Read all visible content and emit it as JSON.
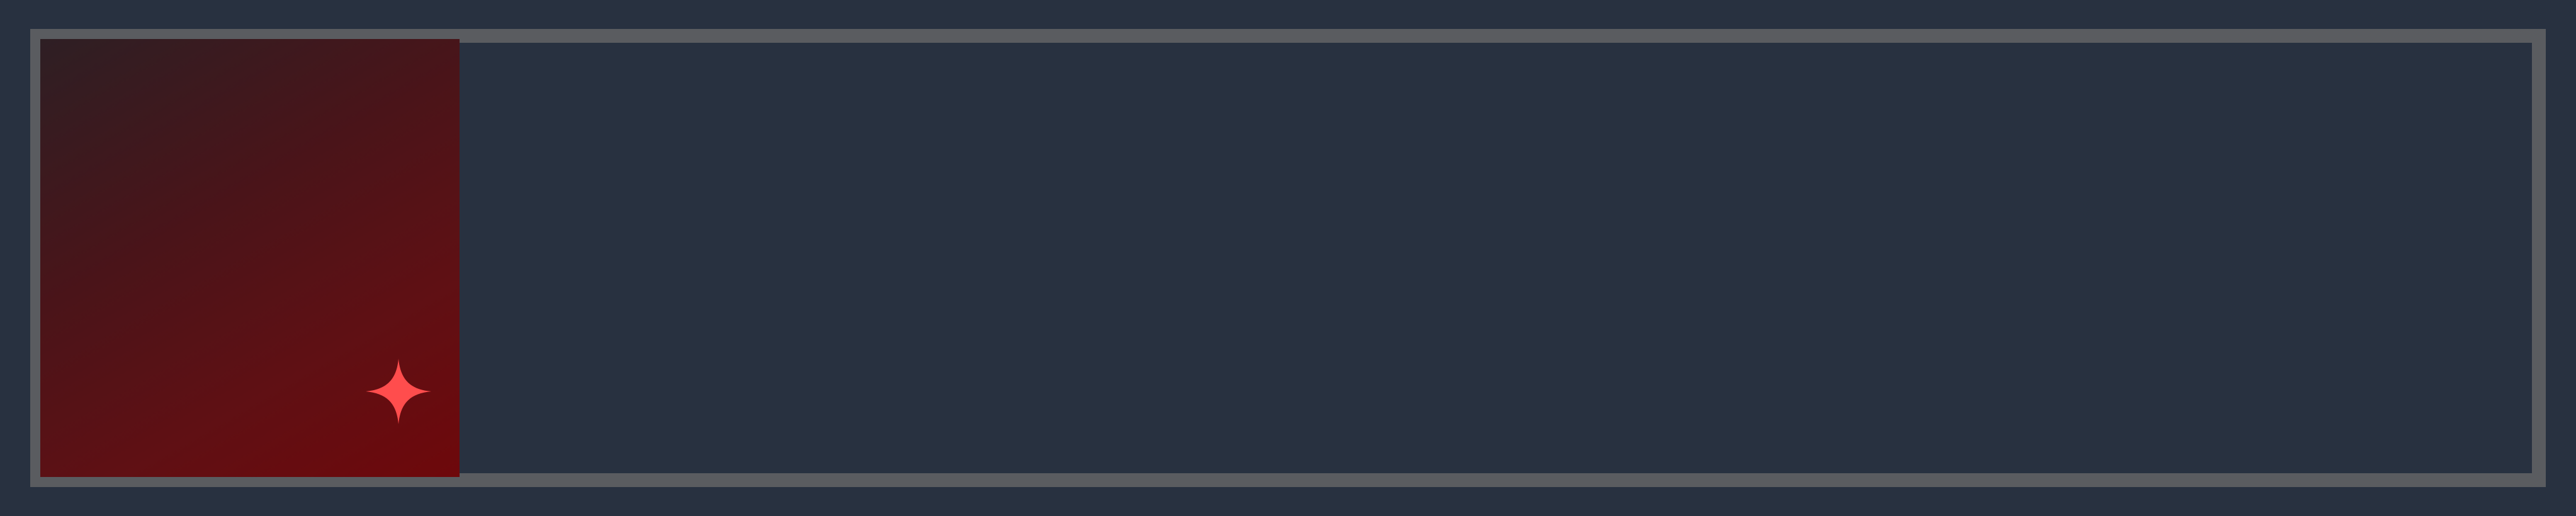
{
  "progress": {
    "fraction": 0.167,
    "fill_gradient_start": "#2e1f24",
    "fill_gradient_end": "#6e080b",
    "track_color": "#283140",
    "border_color": "#5a5c60"
  },
  "colors": {
    "background": "#283140",
    "sparkle": "#ff4d4d"
  },
  "icons": {
    "sparkle": "sparkle-icon"
  }
}
